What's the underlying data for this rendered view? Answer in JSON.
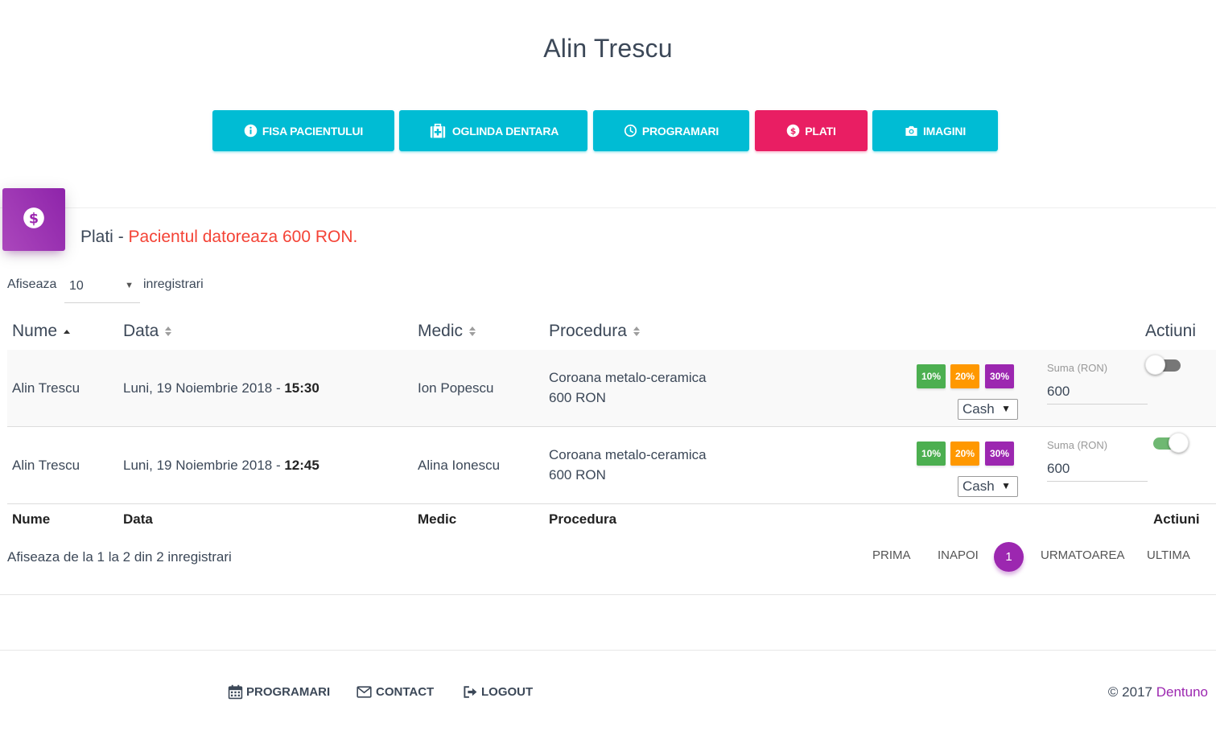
{
  "page": {
    "title": "Alin Trescu"
  },
  "tabs": [
    {
      "label": "FISA PACIENTULUI",
      "icon": "info-icon",
      "active": false
    },
    {
      "label": "OGLINDA DENTARA",
      "icon": "medical-kit-icon",
      "active": false
    },
    {
      "label": "PROGRAMARI",
      "icon": "clock-icon",
      "active": false
    },
    {
      "label": "PLATI",
      "icon": "dollar-icon",
      "active": true
    },
    {
      "label": "IMAGINI",
      "icon": "camera-icon",
      "active": false
    }
  ],
  "card": {
    "icon": "dollar-icon",
    "title": "Plati",
    "separator": " - ",
    "debt_message": "Pacientul datoreaza 600 RON."
  },
  "table_length": {
    "prefix": "Afiseaza",
    "value": "10",
    "suffix": "inregistrari"
  },
  "columns": [
    "Nume",
    "Data",
    "Medic",
    "Procedura",
    "Actiuni"
  ],
  "rows": [
    {
      "name": "Alin Trescu",
      "date": "Luni, 19 Noiembrie 2018 - ",
      "time": "15:30",
      "medic": "Ion Popescu",
      "procedure": "Coroana metalo-ceramica",
      "price": "600 RON",
      "discounts": [
        "10%",
        "20%",
        "30%"
      ],
      "payment_method": "Cash",
      "sum_label": "Suma (RON)",
      "sum_value": "600",
      "paid": false
    },
    {
      "name": "Alin Trescu",
      "date": "Luni, 19 Noiembrie 2018 - ",
      "time": "12:45",
      "medic": "Alina Ionescu",
      "procedure": "Coroana metalo-ceramica",
      "price": "600 RON",
      "discounts": [
        "10%",
        "20%",
        "30%"
      ],
      "payment_method": "Cash",
      "sum_label": "Suma (RON)",
      "sum_value": "600",
      "paid": true
    }
  ],
  "info": "Afiseaza de la 1 la 2 din 2 inregistrari",
  "pagination": {
    "first": "PRIMA",
    "prev": "INAPOI",
    "current": "1",
    "next": "URMATOAREA",
    "last": "ULTIMA"
  },
  "footer": {
    "links": [
      {
        "label": "PROGRAMARI",
        "icon": "calendar-icon"
      },
      {
        "label": "CONTACT",
        "icon": "envelope-icon"
      },
      {
        "label": "LOGOUT",
        "icon": "logout-icon"
      }
    ],
    "copyright": "© 2017 ",
    "brand": "Dentuno"
  },
  "colors": {
    "primary": "#00bcd4",
    "active": "#e91e63",
    "purple": "#9c27b0",
    "danger": "#f44336",
    "green": "#4caf50",
    "orange": "#ff9800"
  }
}
